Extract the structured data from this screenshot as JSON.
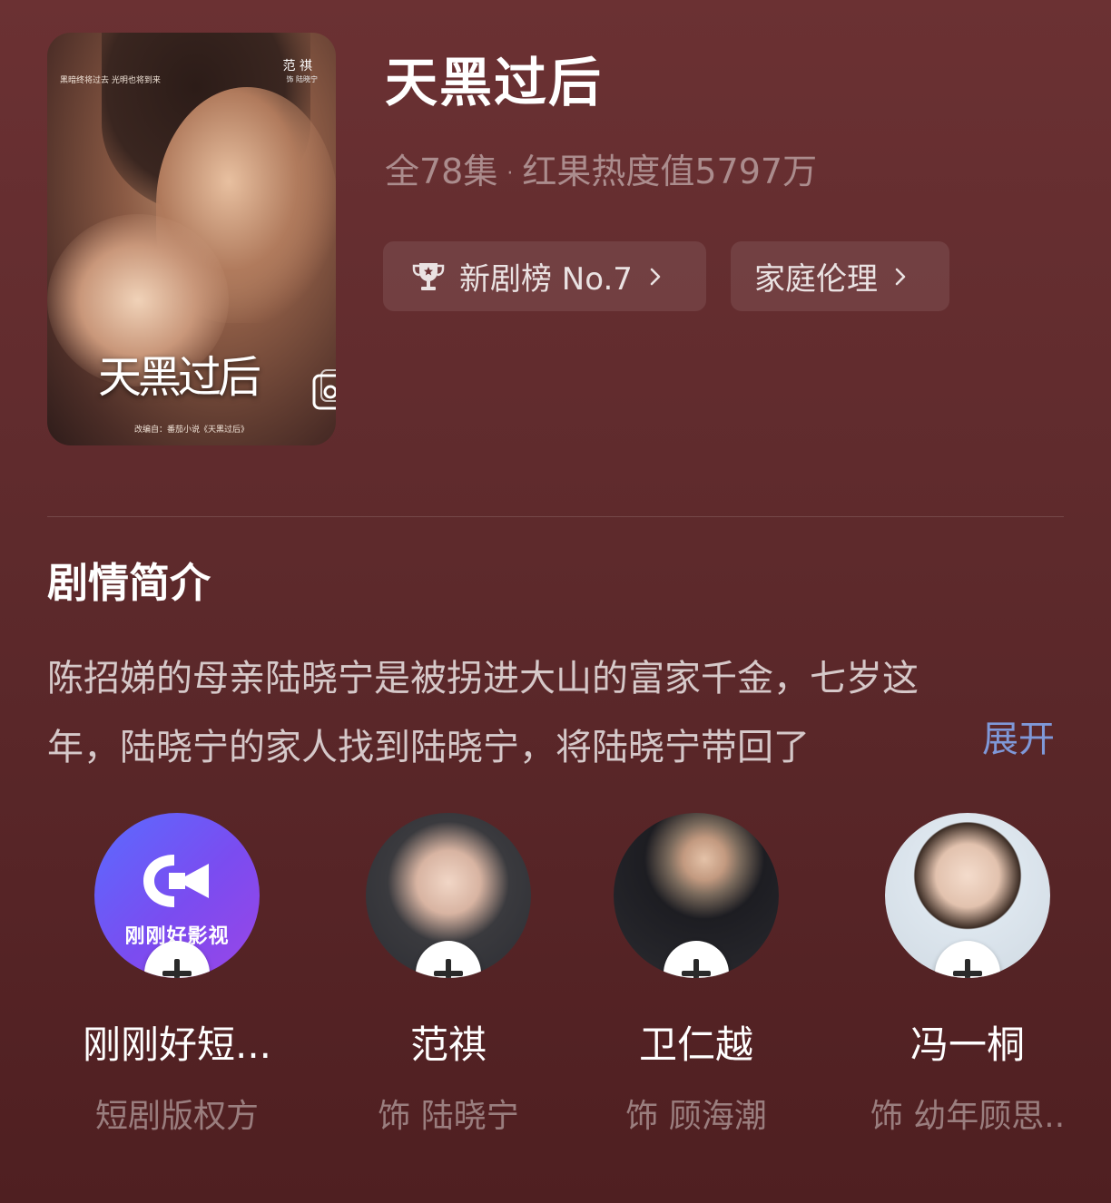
{
  "drama": {
    "title": "天黑过后",
    "episodes": "全78集",
    "separator": "·",
    "heat": "红果热度值5797万"
  },
  "poster": {
    "title_text": "天黑过后",
    "actor": "范 祺",
    "role": "饰 陆晓宁",
    "tagline": "黑暗终将过去 光明也将到来",
    "source": "改编自：番茄小说《天黑过后》"
  },
  "tags": {
    "rank_label": "新剧榜 No.7",
    "genre_label": "家庭伦理"
  },
  "synopsis": {
    "heading": "剧情简介",
    "line1": "陈招娣的母亲陆晓宁是被拐进大山的富家千金，七岁这",
    "line2": "年，陆晓宁的家人找到陆晓宁，将陆晓宁带回了",
    "expand_label": "展开"
  },
  "cast": [
    {
      "name": "刚刚好短...",
      "role": "短剧版权方",
      "logo_text": "刚刚好影视"
    },
    {
      "name": "范祺",
      "role": "饰 陆晓宁"
    },
    {
      "name": "卫仁越",
      "role": "饰 顾海潮"
    },
    {
      "name": "冯一桐",
      "role": "饰 幼年顾思.."
    }
  ],
  "icons": {
    "trophy": "trophy-icon",
    "chevron": "chevron-right-icon",
    "follow": "plus-icon"
  },
  "colors": {
    "background": "#5e2a2c",
    "expand_link": "#7f98d8",
    "brand_gradient_start": "#5a6bff",
    "brand_gradient_end": "#9a45e6"
  }
}
